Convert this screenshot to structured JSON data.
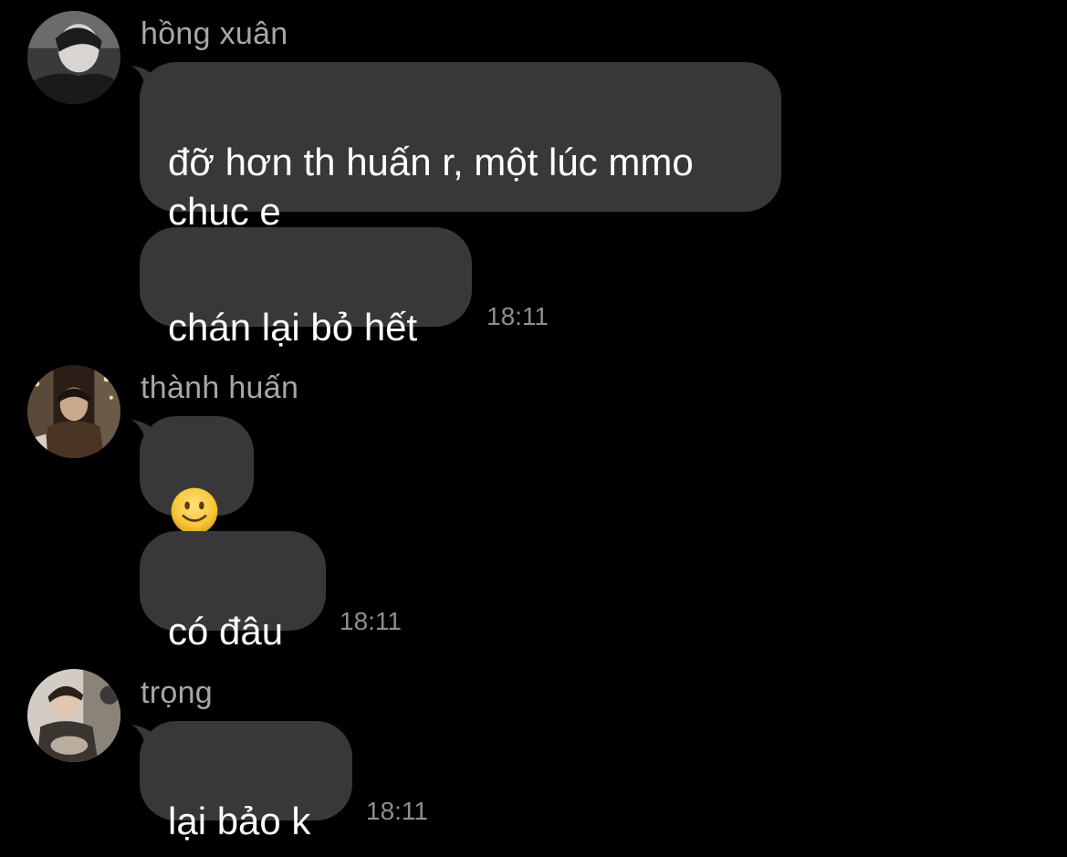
{
  "groups": [
    {
      "sender": "hồng xuân",
      "messages": [
        {
          "text": "đỡ hơn th huấn r, một lúc mmo\nchục e"
        },
        {
          "text": "chán lại bỏ hết"
        }
      ],
      "time": "18:11"
    },
    {
      "sender": "thành huấn",
      "messages": [
        {
          "emoji": "slightly-smiling-face"
        },
        {
          "text": "có đâu"
        }
      ],
      "time": "18:11"
    },
    {
      "sender": "trọng",
      "messages": [
        {
          "text": "lại bảo k"
        }
      ],
      "time": "18:11"
    }
  ],
  "colors": {
    "background": "#000000",
    "bubble": "#38383a",
    "sender_name": "#a7a7ab",
    "timestamp": "#8d8d92",
    "text": "#ffffff"
  }
}
